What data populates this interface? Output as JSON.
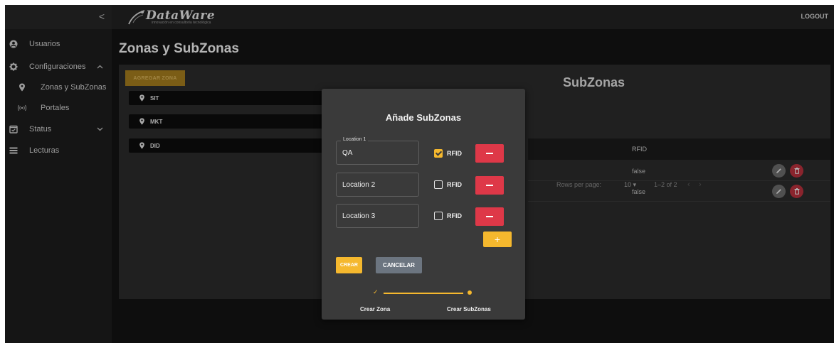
{
  "topbar": {
    "logo_text": "DataWare",
    "logo_tagline": "innovación en consultoría tecnológica",
    "logout_label": "LOGOUT"
  },
  "sidebar": {
    "collapse_glyph": "<",
    "items": [
      {
        "label": "Usuarios",
        "icon": "account-circle-icon"
      },
      {
        "label": "Configuraciones",
        "icon": "gear-icon",
        "chevron": "^"
      },
      {
        "label": "Zonas y SubZonas",
        "icon": "location-pin-icon"
      },
      {
        "label": "Portales",
        "icon": "signal-icon"
      },
      {
        "label": "Status",
        "icon": "checkbox-icon",
        "chevron": "v"
      },
      {
        "label": "Lecturas",
        "icon": "list-icon"
      }
    ]
  },
  "page": {
    "title": "Zonas y SubZonas"
  },
  "zones": {
    "add_label": "AGREGAR ZONA",
    "items": [
      {
        "label": "SIT"
      },
      {
        "label": "MKT"
      },
      {
        "label": "DID"
      }
    ]
  },
  "subzones": {
    "title": "SubZonas",
    "columns": {
      "rfid": "RFID"
    },
    "rows": [
      {
        "rfid": "false"
      },
      {
        "rfid": "false"
      }
    ],
    "pagination": {
      "rows_per_page_label": "Rows per page:",
      "rows_per_page_value": "10 ▾",
      "range": "1–2 of 2",
      "prev": "‹",
      "next": "›"
    }
  },
  "modal": {
    "title": "Añade SubZonas",
    "locations": [
      {
        "legend": "Location 1",
        "value": "QA",
        "rfid_checked": true
      },
      {
        "legend": "",
        "value": "Location 2",
        "rfid_checked": false
      },
      {
        "legend": "",
        "value": "Location 3",
        "rfid_checked": false
      }
    ],
    "rfid_label": "RFID",
    "plus_label": "+",
    "create_label": "CREAR",
    "cancel_label": "CANCELAR",
    "stepper": {
      "step1": "Crear Zona",
      "step2": "Crear SubZonas",
      "check_glyph": "✓"
    }
  },
  "colors": {
    "accent": "#f5b82e",
    "danger": "#de3848",
    "muted_button": "#6c7580"
  }
}
